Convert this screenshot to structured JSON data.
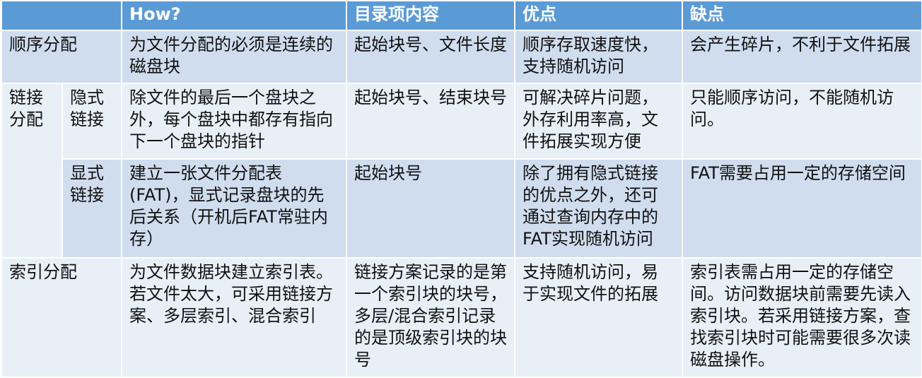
{
  "headers": [
    "",
    "How?",
    "目录项内容",
    "优点",
    "缺点"
  ],
  "rows": {
    "contiguous": {
      "label": "顺序分配",
      "how": "为文件分配的必须是连续的磁盘块",
      "dir": "起始块号、文件长度",
      "pros": "顺序存取速度快，支持随机访问",
      "cons": "会产生碎片，不利于文件拓展"
    },
    "linked_group": {
      "label": "链接分配"
    },
    "implicit": {
      "label": "隐式链接",
      "how": "除文件的最后一个盘块之外，每个盘块中都存有指向下一个盘块的指针",
      "dir": "起始块号、结束块号",
      "pros": "可解决碎片问题，外存利用率高，文件拓展实现方便",
      "cons": "只能顺序访问，不能随机访问。"
    },
    "explicit": {
      "label": "显式链接",
      "how": "建立一张文件分配表(FAT)，显式记录盘块的先后关系（开机后FAT常驻内存）",
      "dir": "起始块号",
      "pros": "除了拥有隐式链接的优点之外，还可通过查询内存中的FAT实现随机访问",
      "cons": "FAT需要占用一定的存储空间"
    },
    "indexed": {
      "label": "索引分配",
      "how": "为文件数据块建立索引表。若文件太大，可采用链接方案、多层索引、混合索引",
      "dir": "链接方案记录的是第一个索引块的块号，多层/混合索引记录的是顶级索引块的块号",
      "pros": "支持随机访问，易于实现文件的拓展",
      "cons": "索引表需占用一定的存储空间。访问数据块前需要先读入索引块。若采用链接方案，查找索引块时可能需要很多次读磁盘操作。"
    }
  }
}
